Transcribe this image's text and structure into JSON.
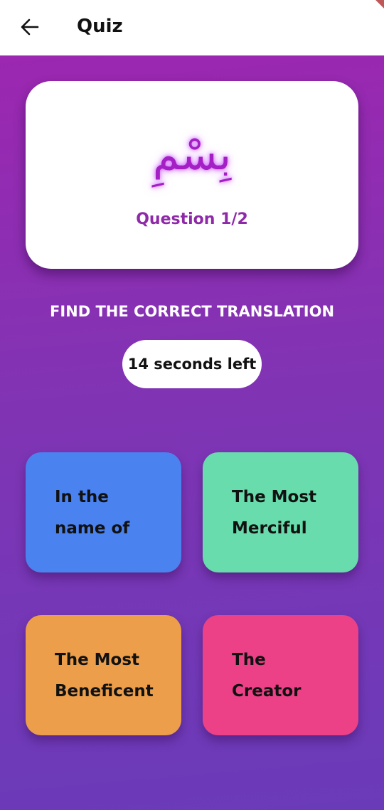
{
  "app_bar": {
    "title": "Quiz",
    "back_icon": "arrow-left-icon"
  },
  "quiz": {
    "arabic_word": "بِسْمِ",
    "question_counter": "Question 1/2",
    "instruction": "FIND THE CORRECT TRANSLATION",
    "timer": "14 seconds left"
  },
  "options": [
    {
      "label": "In the name of",
      "color": "#4a82f0"
    },
    {
      "label": "The Most Merciful",
      "color": "#68dcac"
    },
    {
      "label": "The Most Beneficent",
      "color": "#ec9e4b"
    },
    {
      "label": "The Creator",
      "color": "#ec4186"
    }
  ],
  "colors": {
    "background_top": "#9c27b0",
    "background_bottom": "#6a3bb9",
    "accent_text": "#8e2aa8"
  }
}
